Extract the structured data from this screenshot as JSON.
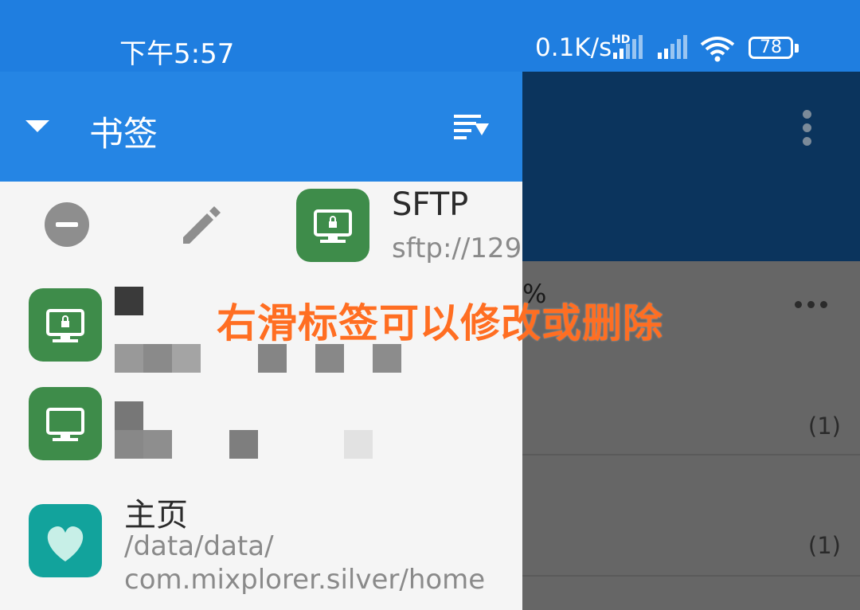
{
  "status_bar": {
    "time": "下午5:57",
    "net_speed": "0.1K/s",
    "hd_label": "HD",
    "battery": "78",
    "icons": [
      "signal-icon",
      "signal-icon",
      "wifi-icon",
      "battery-icon"
    ]
  },
  "drawer": {
    "title": "书签",
    "actions": [
      "remove-icon",
      "edit-icon"
    ],
    "items": [
      {
        "title": "SFTP",
        "subtitle": "sftp://129.",
        "icon": "sftp-lock-monitor-icon"
      },
      {
        "title": "",
        "subtitle": "",
        "icon": "sftp-lock-monitor-icon"
      },
      {
        "title": "",
        "subtitle": "",
        "icon": "sftp-lock-monitor-icon"
      },
      {
        "title": "主页",
        "subtitle_line1": "/data/data/",
        "subtitle_line2": "com.mixplorer.silver/home",
        "icon": "heart-icon"
      }
    ]
  },
  "background": {
    "percent_fragment": "%",
    "counts": [
      "(1)",
      "(1)"
    ]
  },
  "overlay": {
    "caption": "右滑标签可以修改或删除"
  },
  "colors": {
    "status_bar": "#1f7ee0",
    "drawer_header": "#2585e4",
    "bg_header": "#0b345d",
    "tile_green": "#3e8c4a",
    "tile_teal": "#12a39c",
    "caption": "#ff6e22"
  }
}
